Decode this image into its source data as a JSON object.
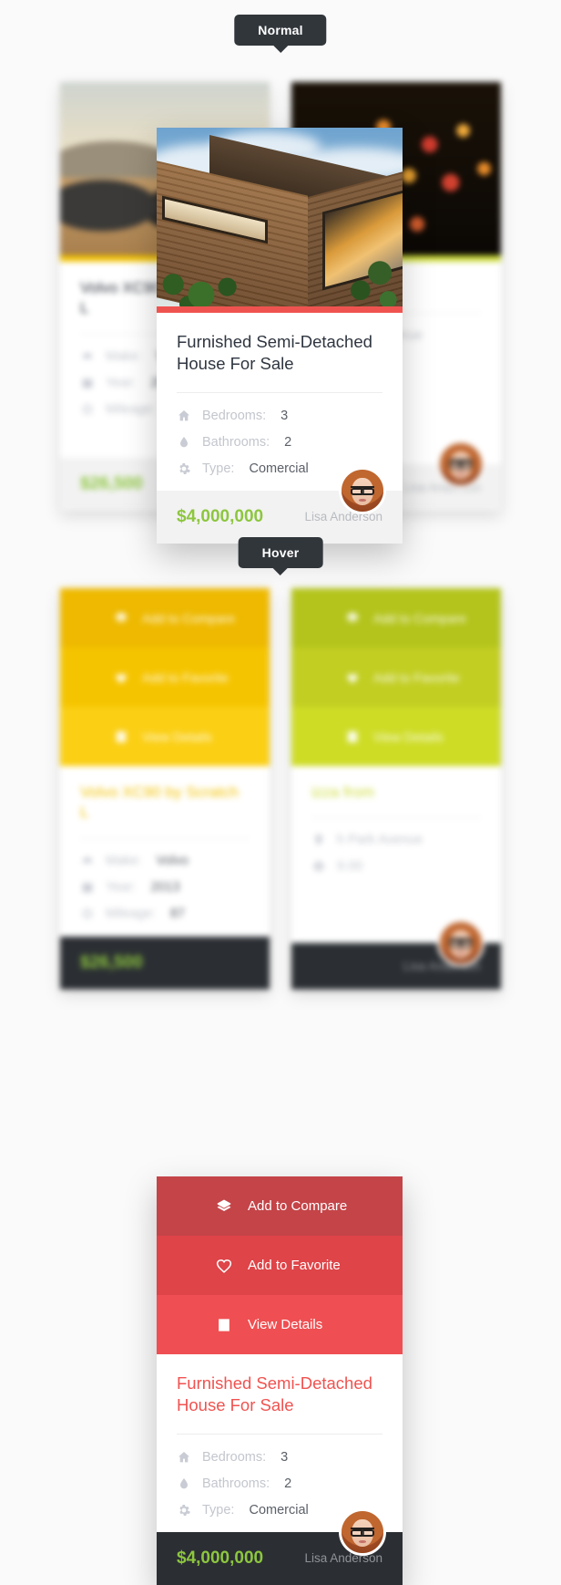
{
  "states": {
    "normal_label": "Normal",
    "hover_label": "Hover"
  },
  "colors": {
    "page_background": "#fafafa",
    "accent_red": "#ef5350",
    "price_green": "#8dc63f",
    "footer_light": "#f2f2f2",
    "footer_dark": "#2b2f33",
    "action_1": "#c44448",
    "action_2": "#de4448",
    "action_3": "#ef4f52",
    "label_pill": "#31363b",
    "side_card_yellow": "#f5c400",
    "side_card_lime": "#c2ce22",
    "side_card_accent_left": "#f2c200",
    "side_card_accent_right": "#cddc39"
  },
  "featured_card": {
    "title": "Furnished Semi-Detached House For Sale",
    "photo_alt": "modern-wooden-house-photo",
    "accent_bar_color": "#ef5350",
    "specs": [
      {
        "icon": "home-icon",
        "label": "Bedrooms:",
        "value": "3"
      },
      {
        "icon": "drop-icon",
        "label": "Bathrooms:",
        "value": "2"
      },
      {
        "icon": "gear-icon",
        "label": "Type:",
        "value": "Comercial"
      }
    ],
    "price": "$4,000,000",
    "agent": "Lisa Anderson",
    "actions": [
      {
        "icon": "layers-icon",
        "label": "Add to Compare"
      },
      {
        "icon": "heart-icon",
        "label": "Add to Favorite"
      },
      {
        "icon": "list-icon",
        "label": "View Details"
      }
    ]
  },
  "side_card_left": {
    "title": "Volvo XC90 by Scratch L",
    "photo_alt": "suv-desert-photo",
    "accent_bar_color": "#f2c200",
    "specs": [
      {
        "icon": "car-icon",
        "label": "Make:",
        "value": "Volvo"
      },
      {
        "icon": "calendar-icon",
        "label": "Year:",
        "value": "2013"
      },
      {
        "icon": "gauge-icon",
        "label": "Mileage:",
        "value": "87"
      }
    ],
    "price": "$26,500",
    "agent": ""
  },
  "side_card_right": {
    "title": "izza from",
    "photo_alt": "food-pizza-photo",
    "accent_bar_color": "#cddc39",
    "specs": [
      {
        "icon": "pin-icon",
        "label": "h Park Avenue",
        "value": ""
      },
      {
        "icon": "price-icon",
        "label": "9.00",
        "value": ""
      }
    ],
    "price": "",
    "agent": "Lisa Anderson"
  }
}
